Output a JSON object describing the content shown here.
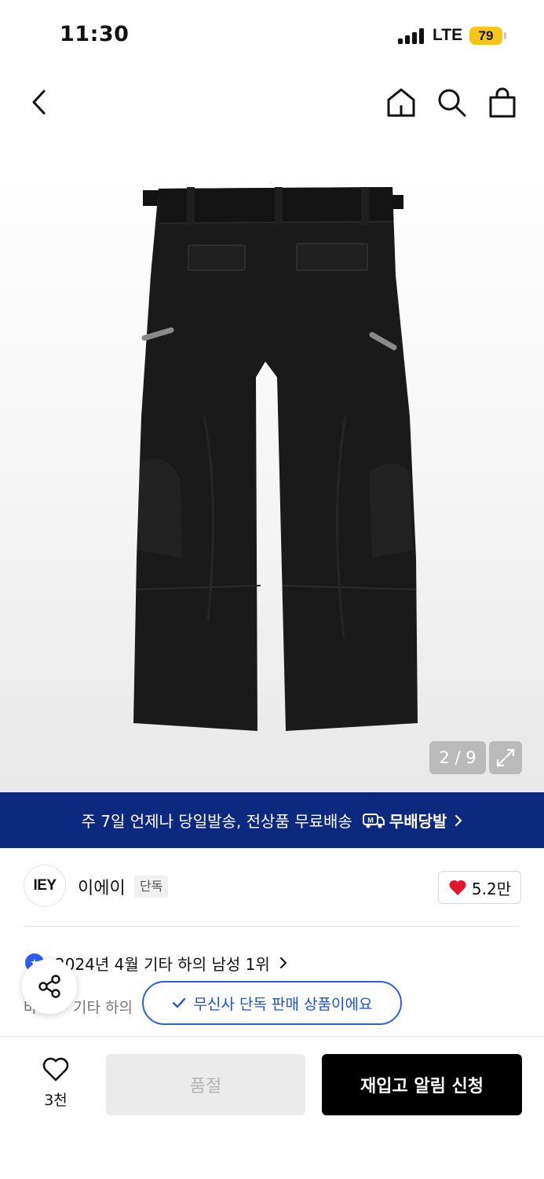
{
  "status_bar": {
    "time": "11:30",
    "network": "LTE",
    "battery": "79"
  },
  "nav": {
    "icons": [
      "back-chevron-icon",
      "home-icon",
      "search-icon",
      "shopping-bag-icon"
    ]
  },
  "gallery": {
    "counter": "2 / 9",
    "expand_icon": "expand-icon"
  },
  "banner": {
    "text": "주 7일 언제나 당일발송, 전상품 무료배송",
    "badge": "무배당발"
  },
  "brand": {
    "logo_text": "IEY",
    "name": "이에이",
    "tag": "단독",
    "likes": "5.2만"
  },
  "ranking": {
    "text": "2024년 4월 기타 하의 남성 1위",
    "category": "바지 > 기타 하의"
  },
  "exclusive": {
    "text": "무신사 단독 판매 상품이에요"
  },
  "bottom": {
    "wish_count": "3천",
    "soldout_label": "품절",
    "restock_label": "재입고 알림 신청"
  },
  "colors": {
    "banner_bg": "#0b2a7f",
    "accent_blue": "#2c5de6",
    "battery": "#f5c518",
    "heart": "#e0182d"
  }
}
